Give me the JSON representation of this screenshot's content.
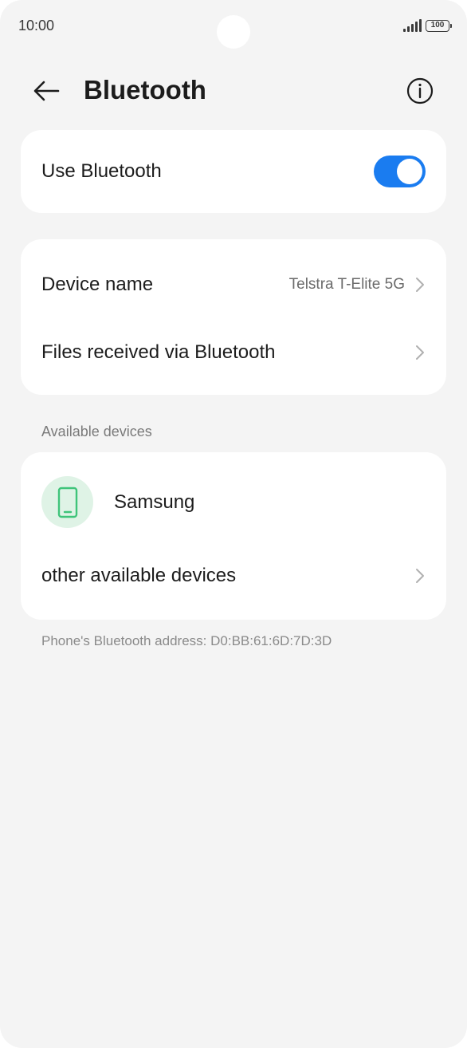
{
  "status_bar": {
    "time": "10:00",
    "battery": "100"
  },
  "header": {
    "title": "Bluetooth",
    "back_icon": "arrow-left-icon",
    "info_icon": "info-circle-icon"
  },
  "bluetooth_toggle": {
    "label": "Use Bluetooth",
    "enabled": true,
    "accent_color": "#1a7cf0"
  },
  "settings": {
    "device_name_label": "Device name",
    "device_name_value": "Telstra T-Elite 5G",
    "files_received_label": "Files received via Bluetooth"
  },
  "available_devices": {
    "heading": "Available devices",
    "devices": [
      {
        "name": "Samsung",
        "icon": "phone-icon",
        "icon_color": "#3fc47a"
      }
    ],
    "other_label": "other available devices"
  },
  "footer": {
    "address_text": "Phone's Bluetooth address: D0:BB:61:6D:7D:3D"
  }
}
